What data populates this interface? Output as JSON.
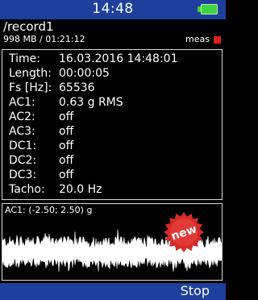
{
  "status_bar": {
    "time": "14:48",
    "battery_color": "#3fd43f"
  },
  "record": {
    "path": "/record1",
    "info": "998 MB / 01:21:12",
    "meas_label": "meas",
    "meas_color": "#e0201c"
  },
  "details": [
    {
      "key": "Time:",
      "value": "16.03.2016 14:48:01"
    },
    {
      "key": "Length:",
      "value": "00:00:05"
    },
    {
      "key": "Fs [Hz]:",
      "value": "65536"
    },
    {
      "key": "AC1:",
      "value": "0.63 g RMS"
    },
    {
      "key": "AC2:",
      "value": "off"
    },
    {
      "key": "AC3:",
      "value": "off"
    },
    {
      "key": "DC1:",
      "value": "off"
    },
    {
      "key": "DC2:",
      "value": "off"
    },
    {
      "key": "DC3:",
      "value": "off"
    },
    {
      "key": "Tacho:",
      "value": "20.0 Hz"
    }
  ],
  "graph": {
    "label": "AC1: (-2.50; 2.50) g"
  },
  "badge": {
    "text": "new",
    "color": "#d42a2a"
  },
  "bottom_bar": {
    "stop_label": "Stop"
  },
  "colors": {
    "bars": "#1e3f9c",
    "background": "#000000",
    "signal": "#ffffff"
  }
}
